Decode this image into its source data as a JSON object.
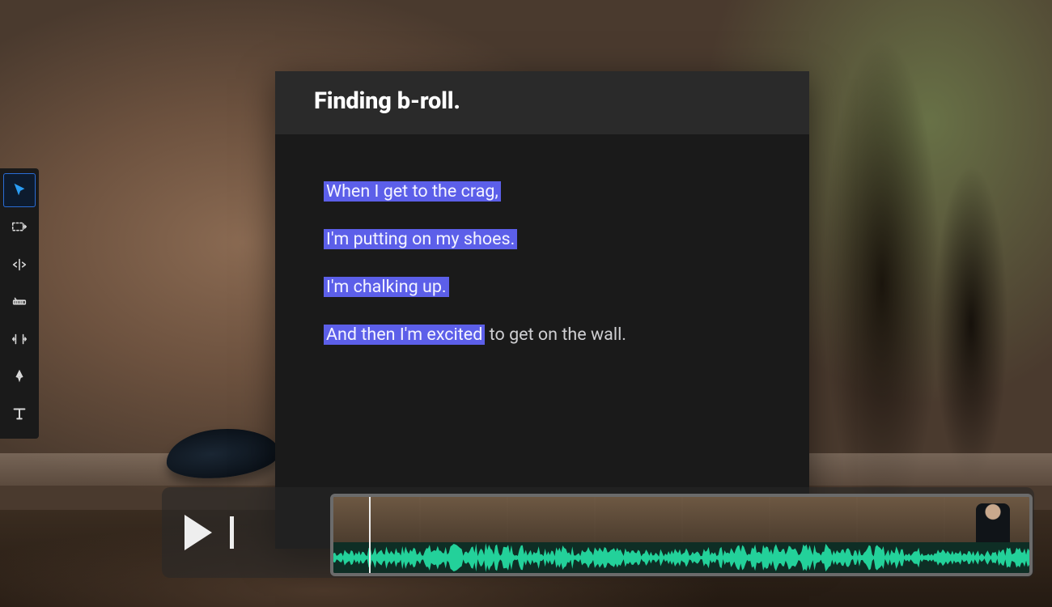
{
  "panel": {
    "title": "Finding b-roll.",
    "lines": [
      {
        "text": "When I get to the crag,",
        "highlight_chars": 23
      },
      {
        "text": "I'm putting on my shoes.",
        "highlight_chars": 24
      },
      {
        "text": "I'm chalking up.",
        "highlight_chars": 16
      },
      {
        "text": "And then I'm excited to get on the wall.",
        "highlight_chars": 20
      }
    ]
  },
  "toolbar": {
    "tools": [
      {
        "name": "selection-tool",
        "active": true
      },
      {
        "name": "track-select-tool",
        "active": false
      },
      {
        "name": "ripple-edit-tool",
        "active": false
      },
      {
        "name": "razor-tool",
        "active": false
      },
      {
        "name": "slip-tool",
        "active": false
      },
      {
        "name": "pen-tool",
        "active": false
      },
      {
        "name": "type-tool",
        "active": false
      }
    ]
  },
  "playback": {
    "state": "paused"
  },
  "colors": {
    "highlight": "#5c5fe9",
    "waveform": "#23d19a",
    "active_tool": "#2a9df4"
  }
}
